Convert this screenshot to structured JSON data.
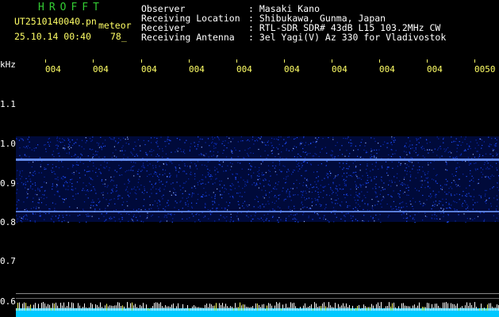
{
  "header": {
    "brand": "HROFFT",
    "filename": "UT2510140040.pn",
    "filename_suffix": "meteor",
    "datetime": "25.10.14 00:40",
    "count": "78_",
    "observer_key": "Observer",
    "observer_val": ": Masaki Kano",
    "location_key": "Receiving Location",
    "location_val": ": Shibukawa, Gunma, Japan",
    "receiver_key": "Receiver",
    "receiver_val": ": RTL-SDR SDR# 43dB L15 103.2MHz CW",
    "antenna_key": "Receiving Antenna",
    "antenna_val": ": 3el Yagi(V) Az 330 for Vladivostok"
  },
  "axis": {
    "y_unit": "kHz",
    "y_ticks": [
      "1.1",
      "1.0",
      "0.9",
      "0.8",
      "0.7",
      "0.6"
    ],
    "x_ticks": [
      "004",
      "004",
      "004",
      "004",
      "004",
      "004",
      "004",
      "004",
      "004",
      "0050"
    ]
  },
  "colors": {
    "background": "#000000",
    "brand": "#33cc33",
    "header_text": "#ffffff",
    "x_tick": "#ffff66",
    "noise": "#1a3cff",
    "trace": "#8fb0ff",
    "bottom_bar": "#00c8ff"
  }
}
